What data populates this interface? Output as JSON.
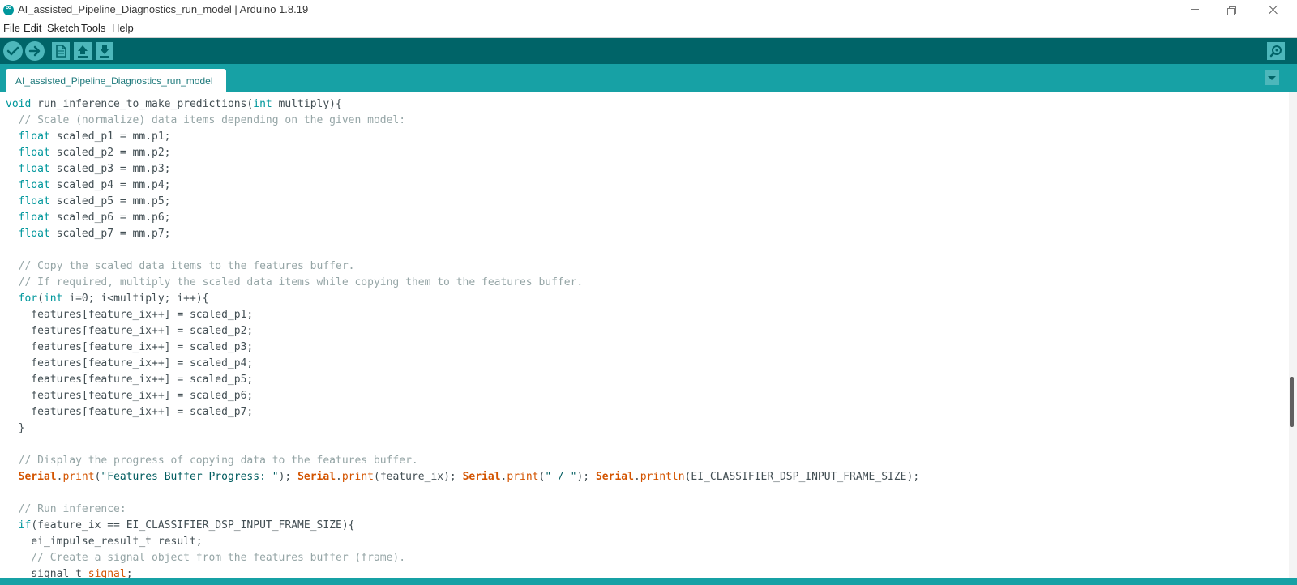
{
  "window": {
    "title": "AI_assisted_Pipeline_Diagnostics_run_model | Arduino 1.8.19",
    "app_icon_glyph": "∞"
  },
  "menu": [
    "File",
    "Edit",
    "Sketch",
    "Tools",
    "Help"
  ],
  "toolbar": {
    "buttons": [
      "verify-icon",
      "upload-icon",
      "new-sketch-icon",
      "open-sketch-icon",
      "save-sketch-icon",
      "serial-monitor-icon"
    ]
  },
  "tabs": [
    {
      "label": "AI_assisted_Pipeline_Diagnostics_run_model"
    }
  ],
  "colors": {
    "toolbar": "#006468",
    "tabbar": "#17a1a5",
    "button": "#4db7bb",
    "keyword": "#00979c",
    "function": "#d35400",
    "comment": "#95a5a6"
  },
  "code_lines": [
    [
      [
        "void",
        "k1"
      ],
      [
        " run_inference_to_make_predictions(",
        ""
      ],
      [
        "int",
        "k1"
      ],
      [
        " multiply){",
        ""
      ]
    ],
    [
      [
        "  // Scale (normalize) data items depending on the given model:",
        "cm"
      ]
    ],
    [
      [
        "  ",
        ""
      ],
      [
        "float",
        "k1"
      ],
      [
        " scaled_p1 = mm.p1;",
        ""
      ]
    ],
    [
      [
        "  ",
        ""
      ],
      [
        "float",
        "k1"
      ],
      [
        " scaled_p2 = mm.p2;",
        ""
      ]
    ],
    [
      [
        "  ",
        ""
      ],
      [
        "float",
        "k1"
      ],
      [
        " scaled_p3 = mm.p3;",
        ""
      ]
    ],
    [
      [
        "  ",
        ""
      ],
      [
        "float",
        "k1"
      ],
      [
        " scaled_p4 = mm.p4;",
        ""
      ]
    ],
    [
      [
        "  ",
        ""
      ],
      [
        "float",
        "k1"
      ],
      [
        " scaled_p5 = mm.p5;",
        ""
      ]
    ],
    [
      [
        "  ",
        ""
      ],
      [
        "float",
        "k1"
      ],
      [
        " scaled_p6 = mm.p6;",
        ""
      ]
    ],
    [
      [
        "  ",
        ""
      ],
      [
        "float",
        "k1"
      ],
      [
        " scaled_p7 = mm.p7;",
        ""
      ]
    ],
    [
      [
        "",
        ""
      ]
    ],
    [
      [
        "  // Copy the scaled data items to the features buffer.",
        "cm"
      ]
    ],
    [
      [
        "  // If required, multiply the scaled data items while copying them to the features buffer.",
        "cm"
      ]
    ],
    [
      [
        "  ",
        ""
      ],
      [
        "for",
        "k1"
      ],
      [
        "(",
        ""
      ],
      [
        "int",
        "k1"
      ],
      [
        " i=0; i<multiply; i++){",
        ""
      ]
    ],
    [
      [
        "    features[feature_ix++] = scaled_p1;",
        ""
      ]
    ],
    [
      [
        "    features[feature_ix++] = scaled_p2;",
        ""
      ]
    ],
    [
      [
        "    features[feature_ix++] = scaled_p3;",
        ""
      ]
    ],
    [
      [
        "    features[feature_ix++] = scaled_p4;",
        ""
      ]
    ],
    [
      [
        "    features[feature_ix++] = scaled_p5;",
        ""
      ]
    ],
    [
      [
        "    features[feature_ix++] = scaled_p6;",
        ""
      ]
    ],
    [
      [
        "    features[feature_ix++] = scaled_p7;",
        ""
      ]
    ],
    [
      [
        "  }",
        ""
      ]
    ],
    [
      [
        "",
        ""
      ]
    ],
    [
      [
        "  // Display the progress of copying data to the features buffer.",
        "cm"
      ]
    ],
    [
      [
        "  ",
        ""
      ],
      [
        "Serial",
        "k2b"
      ],
      [
        ".",
        ""
      ],
      [
        "print",
        "k2"
      ],
      [
        "(",
        ""
      ],
      [
        "\"Features Buffer Progress: \"",
        "st"
      ],
      [
        "); ",
        ""
      ],
      [
        "Serial",
        "k2b"
      ],
      [
        ".",
        ""
      ],
      [
        "print",
        "k2"
      ],
      [
        "(feature_ix); ",
        ""
      ],
      [
        "Serial",
        "k2b"
      ],
      [
        ".",
        ""
      ],
      [
        "print",
        "k2"
      ],
      [
        "(",
        ""
      ],
      [
        "\" / \"",
        "st"
      ],
      [
        "); ",
        ""
      ],
      [
        "Serial",
        "k2b"
      ],
      [
        ".",
        ""
      ],
      [
        "println",
        "k2"
      ],
      [
        "(EI_CLASSIFIER_DSP_INPUT_FRAME_SIZE);",
        ""
      ]
    ],
    [
      [
        "",
        ""
      ]
    ],
    [
      [
        "  // Run inference:",
        "cm"
      ]
    ],
    [
      [
        "  ",
        ""
      ],
      [
        "if",
        "k1"
      ],
      [
        "(feature_ix == EI_CLASSIFIER_DSP_INPUT_FRAME_SIZE){",
        ""
      ]
    ],
    [
      [
        "    ei_impulse_result_t result;",
        ""
      ]
    ],
    [
      [
        "    // Create a signal object from the features buffer (frame).",
        "cm"
      ]
    ],
    [
      [
        "    signal_t ",
        ""
      ],
      [
        "signal",
        "k2"
      ],
      [
        ";",
        ""
      ]
    ]
  ]
}
